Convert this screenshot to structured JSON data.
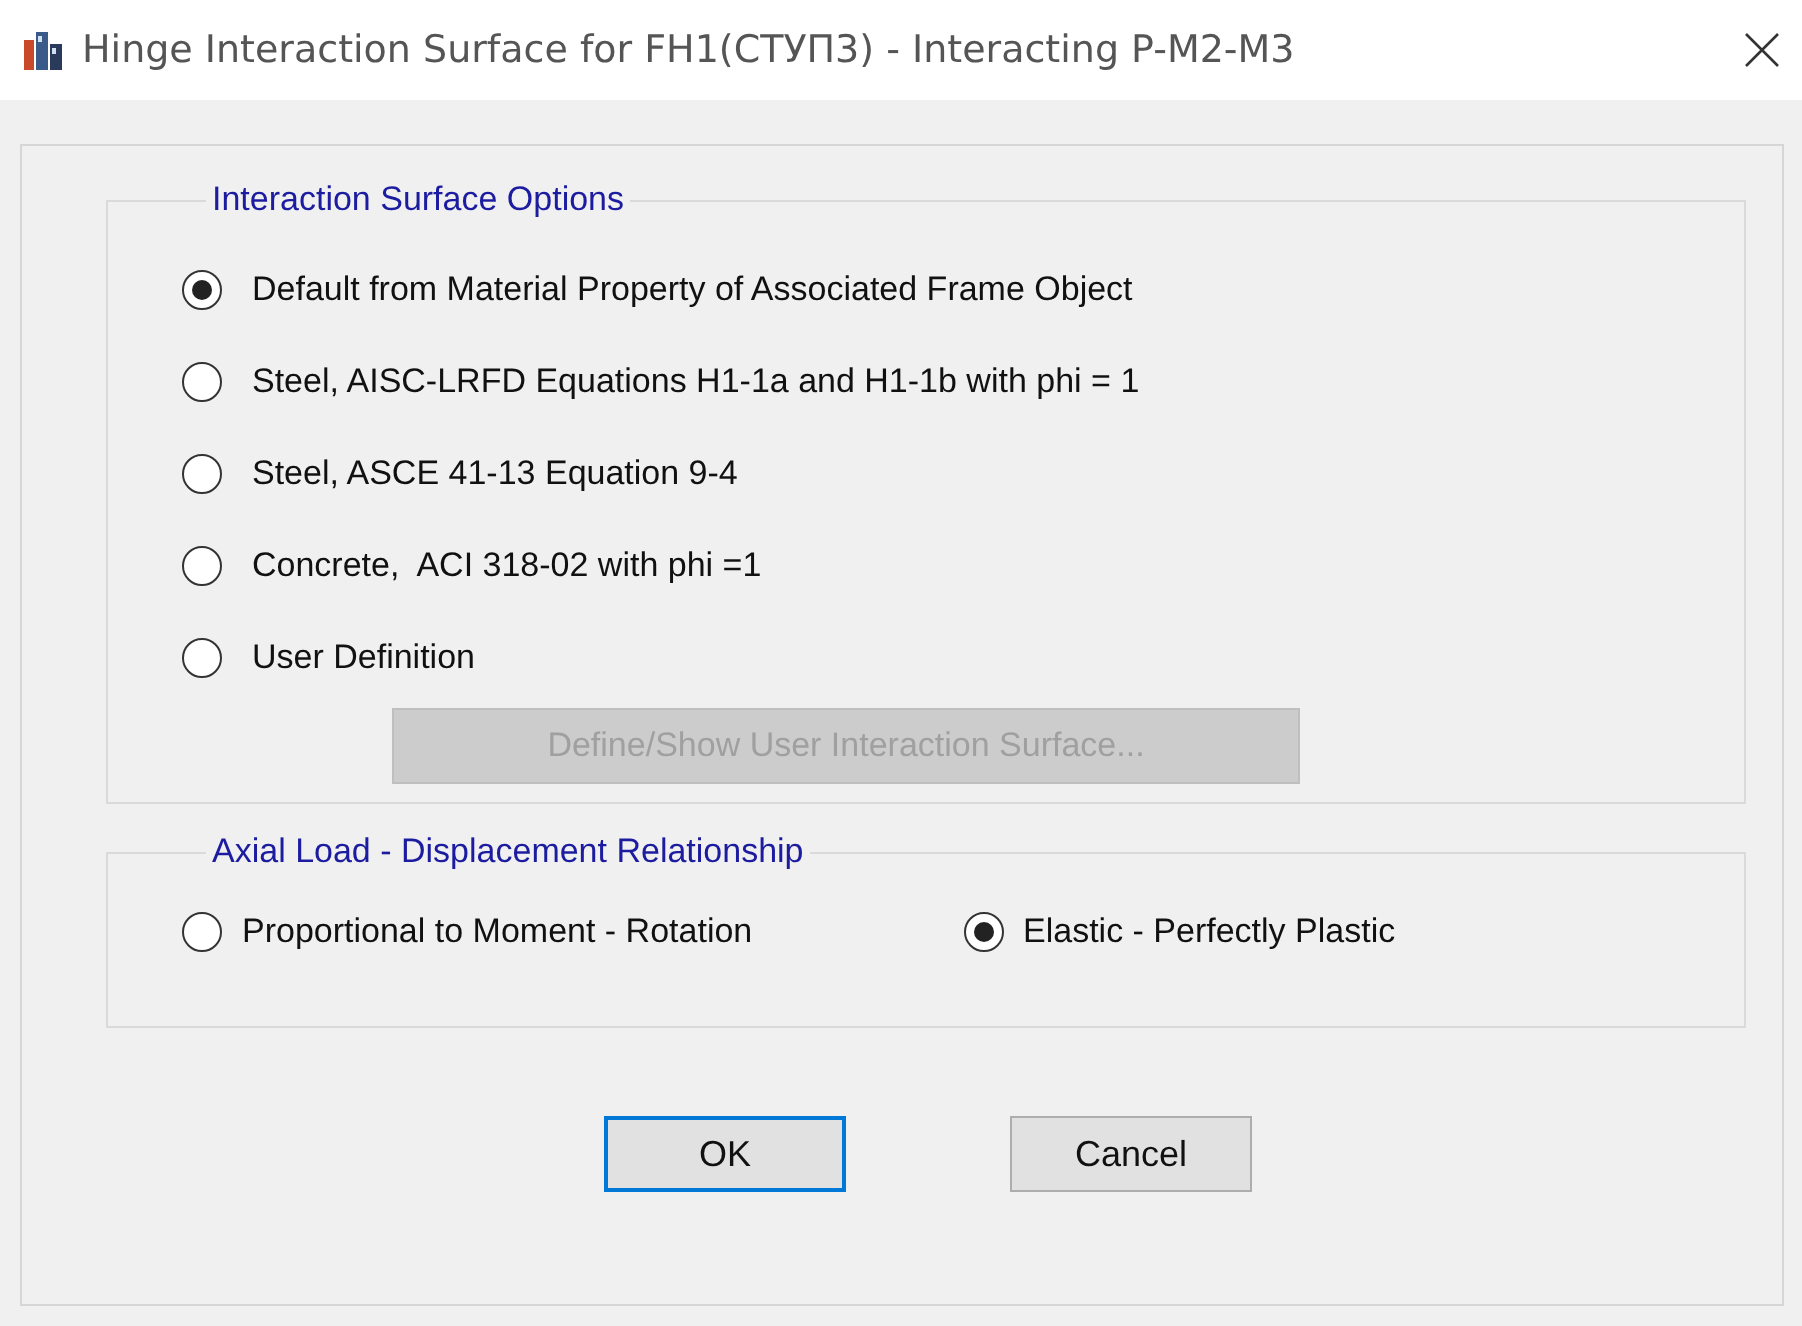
{
  "window": {
    "title": "Hinge Interaction Surface for FH1(СТУП3) - Interacting P-M2-M3"
  },
  "interaction_surface_options": {
    "title": "Interaction Surface Options",
    "options": [
      {
        "label": "Default from Material Property of Associated Frame Object",
        "selected": true
      },
      {
        "label": "Steel, AISC-LRFD Equations H1-1a and H1-1b with phi = 1",
        "selected": false
      },
      {
        "label": "Steel, ASCE 41-13 Equation 9-4",
        "selected": false
      },
      {
        "label": "Concrete,  ACI 318-02 with phi =1",
        "selected": false
      },
      {
        "label": "User Definition",
        "selected": false
      }
    ],
    "define_button": {
      "label": "Define/Show User Interaction Surface...",
      "disabled": true
    }
  },
  "axial_load_relationship": {
    "title": "Axial Load - Displacement Relationship",
    "options": [
      {
        "label": "Proportional to Moment - Rotation",
        "selected": false
      },
      {
        "label": "Elastic - Perfectly Plastic",
        "selected": true
      }
    ]
  },
  "buttons": [
    {
      "label": "OK",
      "focused": true
    },
    {
      "label": "Cancel",
      "focused": false
    }
  ]
}
